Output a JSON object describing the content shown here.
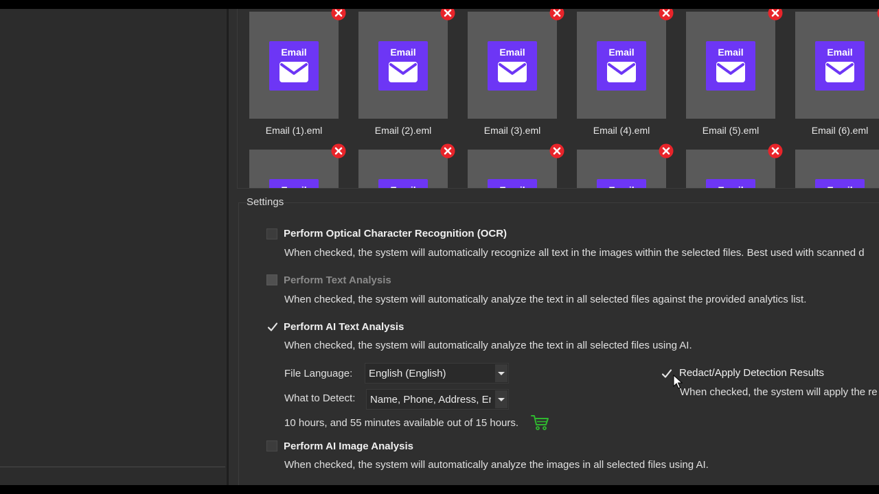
{
  "files": [
    {
      "name": "Email (1).eml"
    },
    {
      "name": "Email (2).eml"
    },
    {
      "name": "Email (3).eml"
    },
    {
      "name": "Email (4).eml"
    },
    {
      "name": "Email (5).eml"
    },
    {
      "name": "Email (6).eml"
    }
  ],
  "file_badge_label": "Email",
  "settings": {
    "title": "Settings",
    "ocr": {
      "checked": false,
      "label": "Perform Optical Character Recognition (OCR)",
      "description": "When checked, the system will automatically recognize all text in the images within the selected files. Best used with scanned d"
    },
    "text_analysis": {
      "checked": false,
      "disabled": true,
      "label": "Perform Text Analysis",
      "description": "When checked, the system will automatically analyze the text in all selected files against the provided analytics list."
    },
    "ai_text_analysis": {
      "checked": true,
      "label": "Perform AI Text Analysis",
      "description": "When checked, the system will automatically analyze the text in all selected files using AI.",
      "file_language_label": "File Language:",
      "file_language_value": "English (English)",
      "what_to_detect_label": "What to Detect:",
      "what_to_detect_value": "Name, Phone, Address, Em",
      "usage_text": "10 hours, and 55 minutes available out of 15 hours.",
      "redact": {
        "checked": true,
        "label": "Redact/Apply Detection Results",
        "description": "When checked, the system will apply the re"
      }
    },
    "ai_image_analysis": {
      "checked": false,
      "label": "Perform AI Image Analysis",
      "description": "When checked, the system will automatically analyze the images in all selected files using AI."
    }
  },
  "colors": {
    "email_badge": "#6d36f5",
    "remove_button": "#e8242a",
    "cart_icon": "#2fb82f"
  },
  "icons": [
    "envelope-icon",
    "remove-icon",
    "checkmark-icon",
    "dropdown-arrow-icon",
    "shopping-cart-icon",
    "mouse-cursor-icon"
  ]
}
